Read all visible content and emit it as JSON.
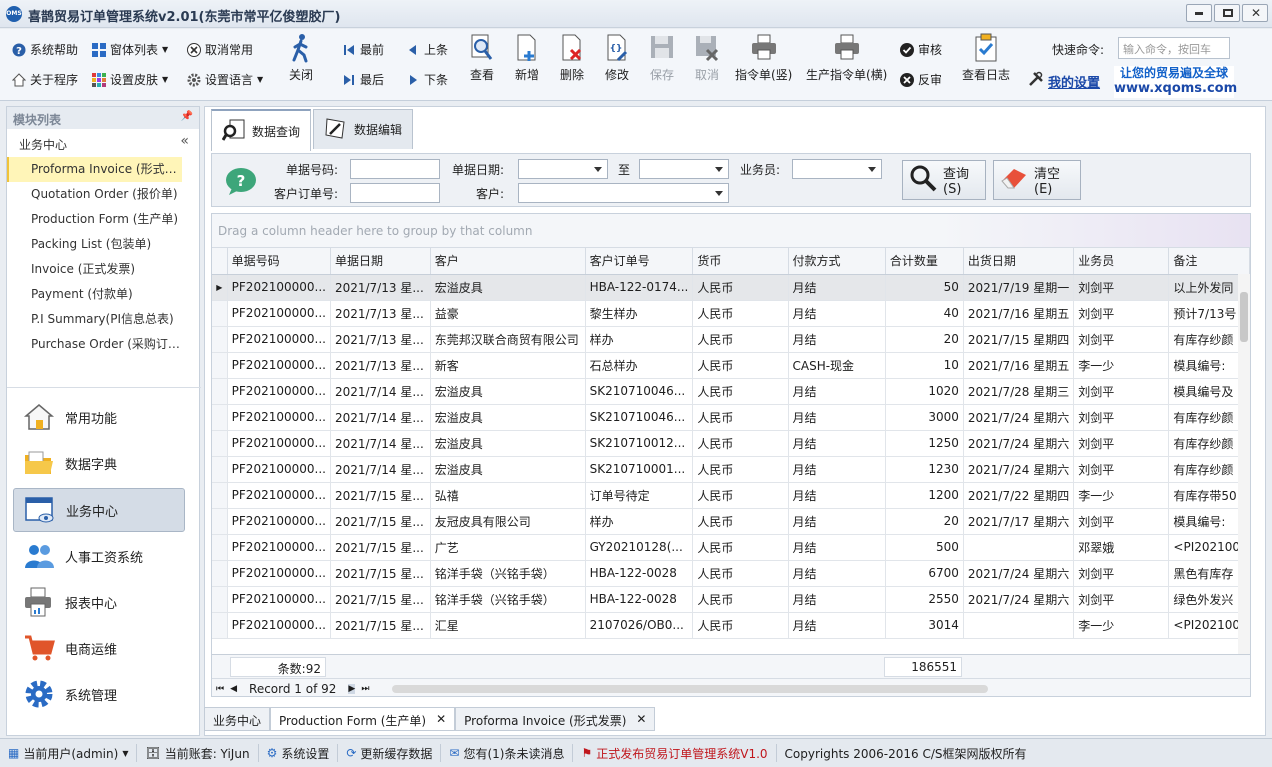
{
  "app": {
    "title": "喜鹊贸易订单管理系统v2.01(东莞市常平亿俊塑胶厂)",
    "logo": "OMS"
  },
  "toolbar": {
    "help": "系统帮助",
    "about": "关于程序",
    "window_list": "窗体列表",
    "skin": "设置皮肤",
    "cancel_common": "取消常用",
    "language": "设置语言",
    "close": "关闭",
    "first": "最前",
    "last": "最后",
    "prev": "上条",
    "next": "下条",
    "view": "查看",
    "add": "新增",
    "delete": "删除",
    "edit": "修改",
    "save": "保存",
    "cancel": "取消",
    "cmd_vertical": "指令单(竖)",
    "cmd_production": "生产指令单(横)",
    "audit": "审核",
    "unaudit": "反审",
    "log": "查看日志",
    "quick_cmd_label": "快速命令:",
    "quick_cmd_placeholder": "输入命令，按回车",
    "my_settings": "我的设置",
    "promo_line1": "让您的贸易遍及全球",
    "promo_line2": "www.xqoms.com"
  },
  "sidebar": {
    "header": "模块列表",
    "group": "业务中心",
    "items": [
      {
        "label": "Proforma Invoice (形式发票)"
      },
      {
        "label": "Quotation Order (报价单)"
      },
      {
        "label": "Production Form (生产单)"
      },
      {
        "label": "Packing List (包装单)"
      },
      {
        "label": "Invoice (正式发票)"
      },
      {
        "label": "Payment (付款单)"
      },
      {
        "label": "P.I Summary(PI信息总表)"
      },
      {
        "label": "Purchase Order (采购订单)"
      }
    ],
    "nav": [
      {
        "label": "常用功能"
      },
      {
        "label": "数据字典"
      },
      {
        "label": "业务中心"
      },
      {
        "label": "人事工资系统"
      },
      {
        "label": "报表中心"
      },
      {
        "label": "电商运维"
      },
      {
        "label": "系统管理"
      }
    ]
  },
  "tabs": {
    "query": "数据查询",
    "edit": "数据编辑"
  },
  "query": {
    "doc_no": "单据号码:",
    "doc_date": "单据日期:",
    "to": "至",
    "salesman": "业务员:",
    "customer_order": "客户订单号:",
    "customer": "客户:",
    "search_btn": "查询(S)",
    "clear_btn": "清空(E)"
  },
  "grid": {
    "group_hint": "Drag a column header here to group by that column",
    "columns": [
      "单据号码",
      "单据日期",
      "客户",
      "客户订单号",
      "货币",
      "付款方式",
      "合计数量",
      "出货日期",
      "业务员",
      "备注"
    ],
    "rows": [
      [
        "PF202100000...",
        "2021/7/13 星...",
        "宏溢皮具",
        "HBA-122-0174...",
        "人民币",
        "月结",
        "50",
        "2021/7/19 星期一",
        "刘剑平",
        "以上外发同"
      ],
      [
        "PF202100000...",
        "2021/7/13 星...",
        "益豪",
        "黎生样办",
        "人民币",
        "月结",
        "40",
        "2021/7/16 星期五",
        "刘剑平",
        "预计7/13号"
      ],
      [
        "PF202100000...",
        "2021/7/13 星...",
        "东莞邦汉联合商贸有限公司",
        "样办",
        "人民币",
        "月结",
        "20",
        "2021/7/15 星期四",
        "刘剑平",
        "有库存纱颜"
      ],
      [
        "PF202100000...",
        "2021/7/13 星...",
        "新客",
        "石总样办",
        "人民币",
        "CASH-现金",
        "10",
        "2021/7/16 星期五",
        "李一少",
        "模具编号:"
      ],
      [
        "PF202100000...",
        "2021/7/14 星...",
        "宏溢皮具",
        "SK210710046...",
        "人民币",
        "月结",
        "1020",
        "2021/7/28 星期三",
        "刘剑平",
        "模具编号及"
      ],
      [
        "PF202100000...",
        "2021/7/14 星...",
        "宏溢皮具",
        "SK210710046...",
        "人民币",
        "月结",
        "3000",
        "2021/7/24 星期六",
        "刘剑平",
        "有库存纱颜"
      ],
      [
        "PF202100000...",
        "2021/7/14 星...",
        "宏溢皮具",
        "SK210710012...",
        "人民币",
        "月结",
        "1250",
        "2021/7/24 星期六",
        "刘剑平",
        "有库存纱颜"
      ],
      [
        "PF202100000...",
        "2021/7/14 星...",
        "宏溢皮具",
        "SK210710001...",
        "人民币",
        "月结",
        "1230",
        "2021/7/24 星期六",
        "刘剑平",
        "有库存纱颜"
      ],
      [
        "PF202100000...",
        "2021/7/15 星...",
        "弘禧",
        "订单号待定",
        "人民币",
        "月结",
        "1200",
        "2021/7/22 星期四",
        "李一少",
        "有库存带50"
      ],
      [
        "PF202100000...",
        "2021/7/15 星...",
        "友冠皮具有限公司",
        "样办",
        "人民币",
        "月结",
        "20",
        "2021/7/17 星期六",
        "刘剑平",
        "模具编号:"
      ],
      [
        "PF202100000...",
        "2021/7/15 星...",
        "广艺",
        "GY20210128(...",
        "人民币",
        "月结",
        "500",
        "",
        "邓翠娥",
        "<PI202100"
      ],
      [
        "PF202100000...",
        "2021/7/15 星...",
        "铭洋手袋（兴铭手袋）",
        "HBA-122-0028",
        "人民币",
        "月结",
        "6700",
        "2021/7/24 星期六",
        "刘剑平",
        "黑色有库存"
      ],
      [
        "PF202100000...",
        "2021/7/15 星...",
        "铭洋手袋（兴铭手袋）",
        "HBA-122-0028",
        "人民币",
        "月结",
        "2550",
        "2021/7/24 星期六",
        "刘剑平",
        "绿色外发兴"
      ],
      [
        "PF202100000...",
        "2021/7/15 星...",
        "汇星",
        "2107026/OB0...",
        "人民币",
        "月结",
        "3014",
        "",
        "李一少",
        "<PI202100"
      ]
    ],
    "count_label": "条数:92",
    "total_qty": "186551",
    "record_label": "Record 1 of 92"
  },
  "bottom_tabs": [
    "业务中心",
    "Production Form (生产单)",
    "Proforma Invoice (形式发票)"
  ],
  "status": {
    "user": "当前用户(admin)",
    "account": "当前账套: YiJun",
    "settings": "系统设置",
    "refresh": "更新缓存数据",
    "messages": "您有(1)条未读消息",
    "release": "正式发布贸易订单管理系统V1.0",
    "copyright": "Copyrights 2006-2016 C/S框架网版权所有"
  },
  "colors": {
    "accent": "#1f5fae",
    "selected_item": "#fff5b8",
    "link": "#1a48a8",
    "release_red": "#c0161c"
  }
}
